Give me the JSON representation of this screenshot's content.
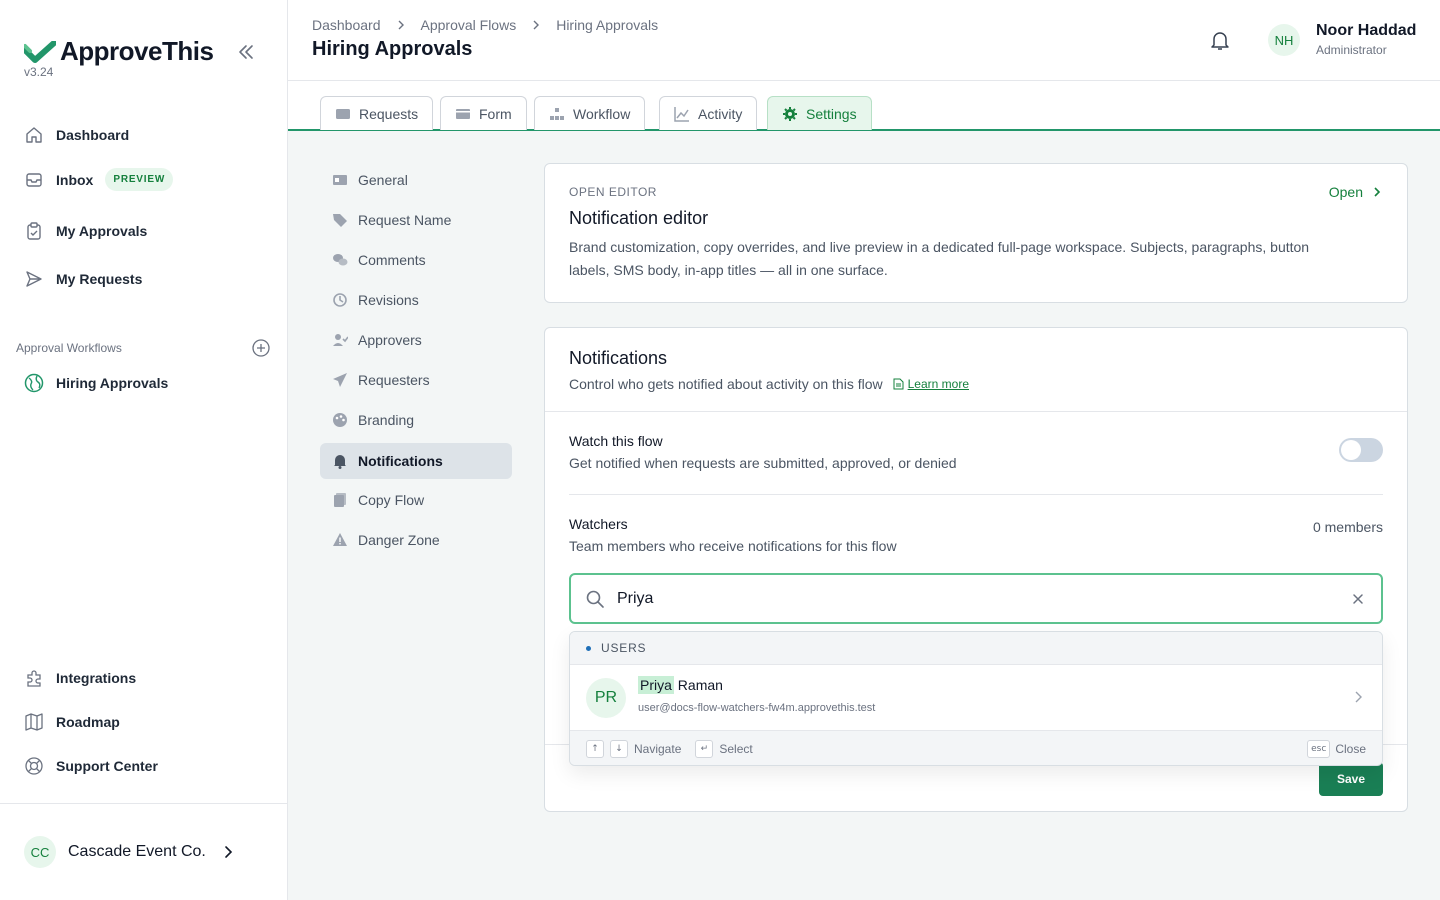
{
  "app": {
    "name": "ApproveThis",
    "version": "v3.24",
    "brand_color": "#22966a"
  },
  "sidebar": {
    "nav": [
      {
        "label": "Dashboard",
        "icon": "home-icon"
      },
      {
        "label": "Inbox",
        "icon": "inbox-icon",
        "badge": "PREVIEW"
      },
      {
        "label": "My Approvals",
        "icon": "clipboard-icon"
      },
      {
        "label": "My Requests",
        "icon": "send-icon"
      }
    ],
    "section_label": "Approval Workflows",
    "flows": [
      {
        "label": "Hiring Approvals",
        "icon": "globe-icon"
      }
    ],
    "bottom": [
      {
        "label": "Integrations",
        "icon": "puzzle-icon"
      },
      {
        "label": "Roadmap",
        "icon": "map-icon"
      },
      {
        "label": "Support Center",
        "icon": "lifebuoy-icon"
      }
    ],
    "org": {
      "initials": "CC",
      "name": "Cascade Event Co."
    }
  },
  "header": {
    "breadcrumb": [
      "Dashboard",
      "Approval Flows",
      "Hiring Approvals"
    ],
    "title": "Hiring Approvals",
    "user": {
      "initials": "NH",
      "name": "Noor Haddad",
      "role": "Administrator"
    }
  },
  "tabs": [
    {
      "label": "Requests",
      "icon": "inbox-tray-icon"
    },
    {
      "label": "Form",
      "icon": "form-icon"
    },
    {
      "label": "Workflow",
      "icon": "hierarchy-icon"
    },
    {
      "label": "Activity",
      "icon": "chart-line-icon"
    },
    {
      "label": "Settings",
      "icon": "gear-icon",
      "active": true
    }
  ],
  "settings_menu": [
    {
      "label": "General",
      "icon": "id-card-icon"
    },
    {
      "label": "Request Name",
      "icon": "tag-icon"
    },
    {
      "label": "Comments",
      "icon": "comments-icon"
    },
    {
      "label": "Revisions",
      "icon": "history-icon"
    },
    {
      "label": "Approvers",
      "icon": "user-check-icon"
    },
    {
      "label": "Requesters",
      "icon": "paper-plane-icon"
    },
    {
      "label": "Branding",
      "icon": "palette-icon"
    },
    {
      "label": "Notifications",
      "icon": "bell-icon",
      "active": true
    },
    {
      "label": "Copy Flow",
      "icon": "copy-icon"
    },
    {
      "label": "Danger Zone",
      "icon": "warning-icon"
    }
  ],
  "editor_card": {
    "eyebrow": "OPEN EDITOR",
    "title": "Notification editor",
    "description": "Brand customization, copy overrides, and live preview in a dedicated full-page workspace. Subjects, paragraphs, button labels, SMS body, in-app titles — all in one surface.",
    "open_label": "Open"
  },
  "notifications": {
    "title": "Notifications",
    "subtitle": "Control who gets notified about activity on this flow",
    "learn_more": "Learn more",
    "watch_label": "Watch this flow",
    "watch_desc": "Get notified when requests are submitted, approved, or denied",
    "watch_enabled": false,
    "watchers_label": "Watchers",
    "watchers_desc": "Team members who receive notifications for this flow",
    "members_count": "0 members",
    "search_value": "Priya",
    "save_label": "Save"
  },
  "dropdown": {
    "group_label": "USERS",
    "results": [
      {
        "initials": "PR",
        "match": "Priya",
        "rest": " Raman",
        "email": "user@docs-flow-watchers-fw4m.approvethis.test"
      }
    ],
    "footer": {
      "up_key": "↑",
      "down_key": "↓",
      "navigate": "Navigate",
      "enter_key": "↵",
      "select": "Select",
      "esc_key": "esc",
      "close": "Close"
    }
  }
}
